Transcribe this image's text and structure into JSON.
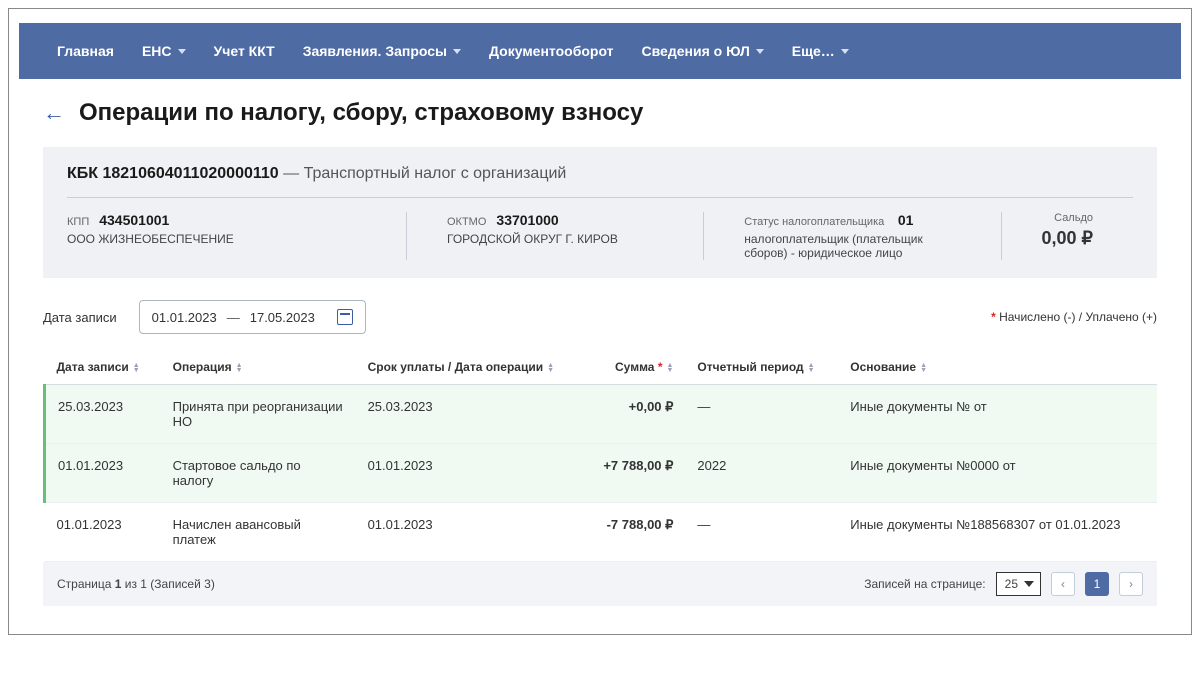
{
  "nav": {
    "items": [
      "Главная",
      "ЕНС",
      "Учет ККТ",
      "Заявления. Запросы",
      "Документооборот",
      "Сведения о ЮЛ",
      "Еще…"
    ],
    "dropdownFlags": [
      false,
      true,
      false,
      true,
      false,
      true,
      true
    ]
  },
  "title": "Операции по налогу, сбору, страховому взносу",
  "panel": {
    "kbk_label": "КБК",
    "kbk_code": "18210604011020000110",
    "kbk_dash": "—",
    "kbk_desc": "Транспортный налог с организаций",
    "kpp_label": "КПП",
    "kpp_value": "434501001",
    "org_name": "ООО ЖИЗНЕОБЕСПЕЧЕНИЕ",
    "oktmo_label": "ОКТМО",
    "oktmo_value": "33701000",
    "oktmo_desc": "ГОРОДСКОЙ ОКРУГ Г. КИРОВ",
    "status_label": "Статус налогоплательщика",
    "status_value": "01",
    "status_desc": "налогоплательщик (плательщик сборов) - юридическое лицо",
    "saldo_label": "Сальдо",
    "saldo_value": "0,00 ₽"
  },
  "filter": {
    "label": "Дата записи",
    "date_from": "01.01.2023",
    "date_to": "17.05.2023",
    "legend": "Начислено (-) / Уплачено (+)",
    "asterisk": "*"
  },
  "table": {
    "headers": {
      "date": "Дата записи",
      "op": "Операция",
      "due": "Срок уплаты / Дата операции",
      "sum": "Сумма",
      "period": "Отчетный период",
      "basis": "Основание"
    },
    "rows": [
      {
        "date": "25.03.2023",
        "op": "Принята при реорганизации НО",
        "due": "25.03.2023",
        "sum": "+0,00 ₽",
        "period": "—",
        "basis": "Иные документы № от",
        "hl": true
      },
      {
        "date": "01.01.2023",
        "op": "Стартовое сальдо по налогу",
        "due": "01.01.2023",
        "sum": "+7 788,00 ₽",
        "period": "2022",
        "basis": "Иные документы №0000 от",
        "hl": true
      },
      {
        "date": "01.01.2023",
        "op": "Начислен авансовый платеж",
        "due": "01.01.2023",
        "sum": "-7 788,00 ₽",
        "period": "—",
        "basis": "Иные документы №188568307 от 01.01.2023",
        "hl": false
      }
    ]
  },
  "footer": {
    "page_info_prefix": "Страница ",
    "page_current": "1",
    "page_info_mid": " из 1 (Записей ",
    "records": "3",
    "page_info_suffix": ")",
    "per_page_label": "Записей на странице:",
    "per_page_value": "25",
    "page_number": "1"
  }
}
